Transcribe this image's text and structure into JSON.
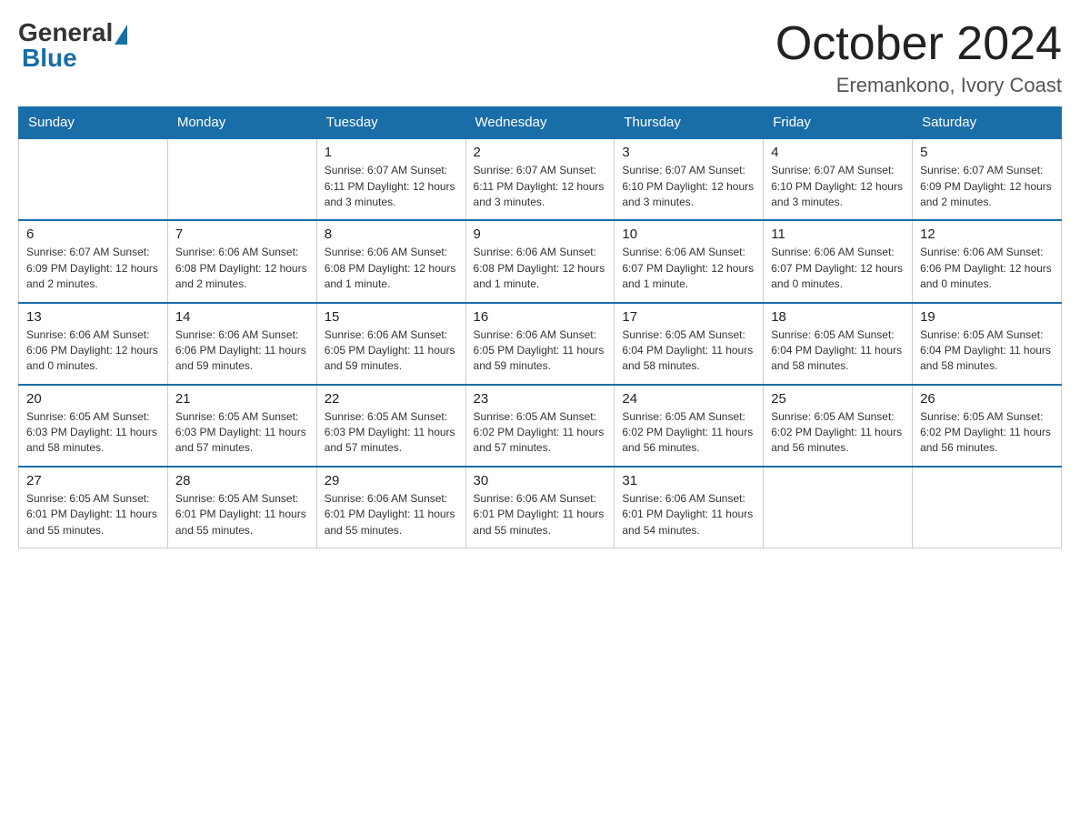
{
  "logo": {
    "general": "General",
    "blue": "Blue"
  },
  "header": {
    "month": "October 2024",
    "location": "Eremankono, Ivory Coast"
  },
  "days_of_week": [
    "Sunday",
    "Monday",
    "Tuesday",
    "Wednesday",
    "Thursday",
    "Friday",
    "Saturday"
  ],
  "weeks": [
    [
      {
        "day": "",
        "info": ""
      },
      {
        "day": "",
        "info": ""
      },
      {
        "day": "1",
        "info": "Sunrise: 6:07 AM\nSunset: 6:11 PM\nDaylight: 12 hours\nand 3 minutes."
      },
      {
        "day": "2",
        "info": "Sunrise: 6:07 AM\nSunset: 6:11 PM\nDaylight: 12 hours\nand 3 minutes."
      },
      {
        "day": "3",
        "info": "Sunrise: 6:07 AM\nSunset: 6:10 PM\nDaylight: 12 hours\nand 3 minutes."
      },
      {
        "day": "4",
        "info": "Sunrise: 6:07 AM\nSunset: 6:10 PM\nDaylight: 12 hours\nand 3 minutes."
      },
      {
        "day": "5",
        "info": "Sunrise: 6:07 AM\nSunset: 6:09 PM\nDaylight: 12 hours\nand 2 minutes."
      }
    ],
    [
      {
        "day": "6",
        "info": "Sunrise: 6:07 AM\nSunset: 6:09 PM\nDaylight: 12 hours\nand 2 minutes."
      },
      {
        "day": "7",
        "info": "Sunrise: 6:06 AM\nSunset: 6:08 PM\nDaylight: 12 hours\nand 2 minutes."
      },
      {
        "day": "8",
        "info": "Sunrise: 6:06 AM\nSunset: 6:08 PM\nDaylight: 12 hours\nand 1 minute."
      },
      {
        "day": "9",
        "info": "Sunrise: 6:06 AM\nSunset: 6:08 PM\nDaylight: 12 hours\nand 1 minute."
      },
      {
        "day": "10",
        "info": "Sunrise: 6:06 AM\nSunset: 6:07 PM\nDaylight: 12 hours\nand 1 minute."
      },
      {
        "day": "11",
        "info": "Sunrise: 6:06 AM\nSunset: 6:07 PM\nDaylight: 12 hours\nand 0 minutes."
      },
      {
        "day": "12",
        "info": "Sunrise: 6:06 AM\nSunset: 6:06 PM\nDaylight: 12 hours\nand 0 minutes."
      }
    ],
    [
      {
        "day": "13",
        "info": "Sunrise: 6:06 AM\nSunset: 6:06 PM\nDaylight: 12 hours\nand 0 minutes."
      },
      {
        "day": "14",
        "info": "Sunrise: 6:06 AM\nSunset: 6:06 PM\nDaylight: 11 hours\nand 59 minutes."
      },
      {
        "day": "15",
        "info": "Sunrise: 6:06 AM\nSunset: 6:05 PM\nDaylight: 11 hours\nand 59 minutes."
      },
      {
        "day": "16",
        "info": "Sunrise: 6:06 AM\nSunset: 6:05 PM\nDaylight: 11 hours\nand 59 minutes."
      },
      {
        "day": "17",
        "info": "Sunrise: 6:05 AM\nSunset: 6:04 PM\nDaylight: 11 hours\nand 58 minutes."
      },
      {
        "day": "18",
        "info": "Sunrise: 6:05 AM\nSunset: 6:04 PM\nDaylight: 11 hours\nand 58 minutes."
      },
      {
        "day": "19",
        "info": "Sunrise: 6:05 AM\nSunset: 6:04 PM\nDaylight: 11 hours\nand 58 minutes."
      }
    ],
    [
      {
        "day": "20",
        "info": "Sunrise: 6:05 AM\nSunset: 6:03 PM\nDaylight: 11 hours\nand 58 minutes."
      },
      {
        "day": "21",
        "info": "Sunrise: 6:05 AM\nSunset: 6:03 PM\nDaylight: 11 hours\nand 57 minutes."
      },
      {
        "day": "22",
        "info": "Sunrise: 6:05 AM\nSunset: 6:03 PM\nDaylight: 11 hours\nand 57 minutes."
      },
      {
        "day": "23",
        "info": "Sunrise: 6:05 AM\nSunset: 6:02 PM\nDaylight: 11 hours\nand 57 minutes."
      },
      {
        "day": "24",
        "info": "Sunrise: 6:05 AM\nSunset: 6:02 PM\nDaylight: 11 hours\nand 56 minutes."
      },
      {
        "day": "25",
        "info": "Sunrise: 6:05 AM\nSunset: 6:02 PM\nDaylight: 11 hours\nand 56 minutes."
      },
      {
        "day": "26",
        "info": "Sunrise: 6:05 AM\nSunset: 6:02 PM\nDaylight: 11 hours\nand 56 minutes."
      }
    ],
    [
      {
        "day": "27",
        "info": "Sunrise: 6:05 AM\nSunset: 6:01 PM\nDaylight: 11 hours\nand 55 minutes."
      },
      {
        "day": "28",
        "info": "Sunrise: 6:05 AM\nSunset: 6:01 PM\nDaylight: 11 hours\nand 55 minutes."
      },
      {
        "day": "29",
        "info": "Sunrise: 6:06 AM\nSunset: 6:01 PM\nDaylight: 11 hours\nand 55 minutes."
      },
      {
        "day": "30",
        "info": "Sunrise: 6:06 AM\nSunset: 6:01 PM\nDaylight: 11 hours\nand 55 minutes."
      },
      {
        "day": "31",
        "info": "Sunrise: 6:06 AM\nSunset: 6:01 PM\nDaylight: 11 hours\nand 54 minutes."
      },
      {
        "day": "",
        "info": ""
      },
      {
        "day": "",
        "info": ""
      }
    ]
  ]
}
